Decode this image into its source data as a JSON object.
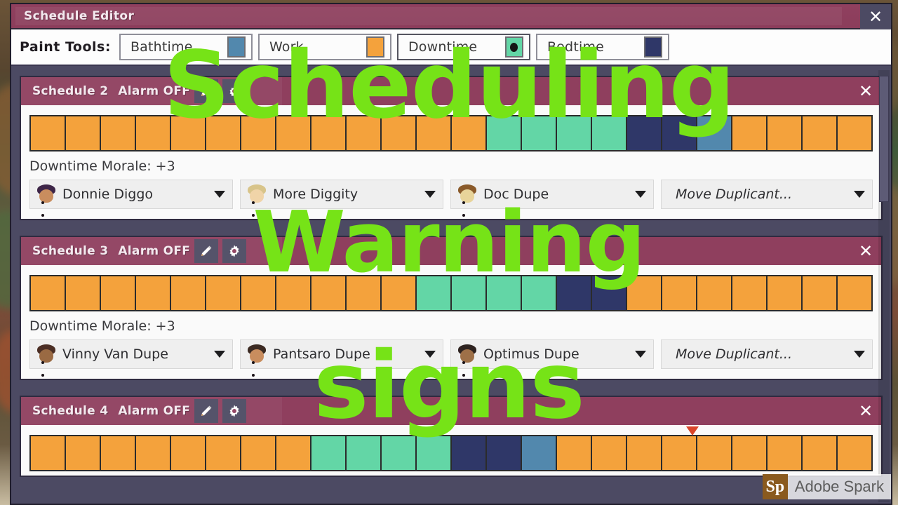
{
  "window": {
    "title": "Schedule Editor",
    "close_label": "✕"
  },
  "paint_tools": {
    "label": "Paint Tools:",
    "items": [
      {
        "name": "Bathtime",
        "color": "#5288ad",
        "selected": false
      },
      {
        "name": "Work",
        "color": "#f4a23c",
        "selected": false
      },
      {
        "name": "Downtime",
        "color": "#63d6a6",
        "selected": true
      },
      {
        "name": "Bedtime",
        "color": "#2f3768",
        "selected": false
      }
    ]
  },
  "legend_colors": {
    "bathtime": "#5288ad",
    "work": "#f4a23c",
    "downtime": "#63d6a6",
    "bedtime": "#2f3768"
  },
  "schedules": [
    {
      "title": "Schedule 2",
      "alarm": "Alarm OFF",
      "morale": "Downtime Morale: +3",
      "marker_block": 18,
      "blocks": [
        "work",
        "work",
        "work",
        "work",
        "work",
        "work",
        "work",
        "work",
        "work",
        "work",
        "work",
        "work",
        "work",
        "downtime",
        "downtime",
        "downtime",
        "downtime",
        "bedtime",
        "bedtime",
        "bathtime",
        "work",
        "work",
        "work",
        "work"
      ],
      "dupes": [
        {
          "name": "Donnie Diggo",
          "skin": "#c98d5e",
          "hair": "#3d2547"
        },
        {
          "name": "More Diggity",
          "skin": "#f0d4a8",
          "hair": "#d8c48a"
        },
        {
          "name": "Doc Dupe",
          "skin": "#e8d49a",
          "hair": "#8a5a2a"
        }
      ],
      "move_label": "Move Duplicant..."
    },
    {
      "title": "Schedule 3",
      "alarm": "Alarm OFF",
      "morale": "Downtime Morale: +3",
      "marker_block": -1,
      "blocks": [
        "work",
        "work",
        "work",
        "work",
        "work",
        "work",
        "work",
        "work",
        "work",
        "work",
        "work",
        "downtime",
        "downtime",
        "downtime",
        "downtime",
        "bedtime",
        "bedtime",
        "work",
        "work",
        "work",
        "work",
        "work",
        "work",
        "work"
      ],
      "dupes": [
        {
          "name": "Vinny Van Dupe",
          "skin": "#9a6a43",
          "hair": "#4b2e24"
        },
        {
          "name": "Pantsaro Dupe",
          "skin": "#c98d5e",
          "hair": "#3b2a22"
        },
        {
          "name": "Optimus Dupe",
          "skin": "#9e7048",
          "hair": "#2e2320"
        }
      ],
      "move_label": "Move Duplicant..."
    },
    {
      "title": "Schedule 4",
      "alarm": "Alarm OFF",
      "morale": "",
      "marker_block": 18,
      "blocks": [
        "work",
        "work",
        "work",
        "work",
        "work",
        "work",
        "work",
        "work",
        "downtime",
        "downtime",
        "downtime",
        "downtime",
        "bedtime",
        "bedtime",
        "bathtime",
        "work",
        "work",
        "work",
        "work",
        "work",
        "work",
        "work",
        "work",
        "work"
      ],
      "dupes": [],
      "move_label": ""
    }
  ],
  "overlay": {
    "line1": "Scheduling",
    "line2": "Warning",
    "line3": "signs",
    "color": "#76e317"
  },
  "watermark": {
    "badge": "Sp",
    "text": "Adobe Spark"
  },
  "icons": {
    "edit": "pencil-icon",
    "settings": "gear-icon",
    "close": "close-icon"
  }
}
